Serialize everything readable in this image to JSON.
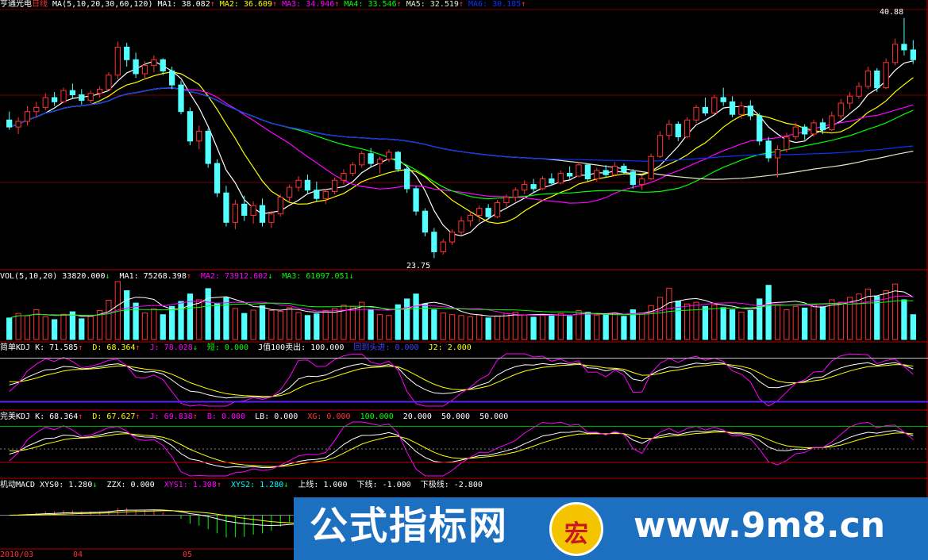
{
  "header": {
    "stock": "亨通光电",
    "period": "日线",
    "ma_params": "MA(5,10,20,30,60,120)",
    "ma1": "MA1: 38.082",
    "ma2": "MA2: 36.609",
    "ma3": "MA3: 34.946",
    "ma4": "MA4: 33.546",
    "ma5": "MA5: 32.519",
    "ma6": "MA6: 30.185",
    "high_label": "40.88",
    "low_label": "23.75"
  },
  "vol_header": {
    "params": "VOL(5,10,20)",
    "vol": "33820.000",
    "ma1": "MA1: 75268.398",
    "ma2": "MA2: 73912.602",
    "ma3": "MA3: 61097.051"
  },
  "kdj1_header": {
    "name": "简单KDJ",
    "k": "K: 71.585",
    "d": "D: 68.364",
    "j": "J: 78.028",
    "short": "短: 0.000",
    "jsell": "J值100卖出: 100.000",
    "bottom": "回到头进: 0.000",
    "j2": "J2: 2.000"
  },
  "kdj2_header": {
    "name": "完美KDJ",
    "k": "K: 68.364",
    "d": "D: 67.627",
    "j": "J: 69.838",
    "b": "B: 0.000",
    "lb": "LB: 0.000",
    "xg": "XG: 0.000",
    "v1": "100.000",
    "v2": "20.000",
    "v3": "50.000",
    "v4": "50.000"
  },
  "macd_header": {
    "name": "机动MACD",
    "xys0": "XYS0: 1.280",
    "zzx": "ZZX: 0.000",
    "xys1": "XYS1: 1.308",
    "xys2": "XYS2: 1.280",
    "upper": "上线: 1.000",
    "lower": "下线: -1.000",
    "floor": "下极线: -2.800"
  },
  "date_labels": [
    "2010/03",
    "04",
    "05"
  ],
  "watermark": {
    "text": "公式指标网",
    "url": "www.9m8.cn",
    "logo_char": "宏"
  },
  "colors": {
    "up": "#ff3232",
    "down": "#54ffff",
    "ma1": "#ffffff",
    "ma2": "#ffff00",
    "ma3": "#ff00ff",
    "ma4": "#00ff00",
    "ma5": "#e8e8c8",
    "ma6": "#0a32ff"
  },
  "chart_data": {
    "type": "candlestick",
    "price_range": [
      23.75,
      40.88
    ],
    "ohlc": [
      [
        33.6,
        34.2,
        32.9,
        33.1
      ],
      [
        33.1,
        33.8,
        32.6,
        33.5
      ],
      [
        33.5,
        34.6,
        33.2,
        34.2
      ],
      [
        34.2,
        34.9,
        33.8,
        34.5
      ],
      [
        34.5,
        35.5,
        34.3,
        35.2
      ],
      [
        35.2,
        35.6,
        34.6,
        34.9
      ],
      [
        34.9,
        35.9,
        34.8,
        35.7
      ],
      [
        35.7,
        36.2,
        35.1,
        35.4
      ],
      [
        35.4,
        35.8,
        34.7,
        35.0
      ],
      [
        35.0,
        35.7,
        34.8,
        35.5
      ],
      [
        35.5,
        36.0,
        35.2,
        35.8
      ],
      [
        35.8,
        37.0,
        35.7,
        36.8
      ],
      [
        36.8,
        39.2,
        36.5,
        38.8
      ],
      [
        38.8,
        39.1,
        37.4,
        37.9
      ],
      [
        37.9,
        38.4,
        36.6,
        36.9
      ],
      [
        36.9,
        37.8,
        36.5,
        37.5
      ],
      [
        37.5,
        38.2,
        37.0,
        37.9
      ],
      [
        37.9,
        38.0,
        36.8,
        37.1
      ],
      [
        37.1,
        37.4,
        35.8,
        36.1
      ],
      [
        36.1,
        36.4,
        34.0,
        34.2
      ],
      [
        34.2,
        34.5,
        31.8,
        32.1
      ],
      [
        32.1,
        33.2,
        31.5,
        32.8
      ],
      [
        32.8,
        33.0,
        30.2,
        30.5
      ],
      [
        30.5,
        30.8,
        28.1,
        28.4
      ],
      [
        28.4,
        28.9,
        26.0,
        26.3
      ],
      [
        26.3,
        27.9,
        25.8,
        27.6
      ],
      [
        27.6,
        28.2,
        26.4,
        26.8
      ],
      [
        26.8,
        27.8,
        26.2,
        27.5
      ],
      [
        27.5,
        28.0,
        26.0,
        26.3
      ],
      [
        26.3,
        27.1,
        25.9,
        26.9
      ],
      [
        26.9,
        28.3,
        26.7,
        28.1
      ],
      [
        28.1,
        29.0,
        27.8,
        28.8
      ],
      [
        28.8,
        29.6,
        28.5,
        29.3
      ],
      [
        29.3,
        29.7,
        28.3,
        28.6
      ],
      [
        28.6,
        29.2,
        27.8,
        28.0
      ],
      [
        28.0,
        28.7,
        27.6,
        28.5
      ],
      [
        28.5,
        29.5,
        28.3,
        29.3
      ],
      [
        29.3,
        30.1,
        29.0,
        29.8
      ],
      [
        29.8,
        30.6,
        29.6,
        30.4
      ],
      [
        30.4,
        31.4,
        30.2,
        31.2
      ],
      [
        31.2,
        31.6,
        30.2,
        30.5
      ],
      [
        30.5,
        31.0,
        29.8,
        30.8
      ],
      [
        30.8,
        31.5,
        30.6,
        31.3
      ],
      [
        31.3,
        31.4,
        29.9,
        30.1
      ],
      [
        30.1,
        30.3,
        28.4,
        28.7
      ],
      [
        28.7,
        28.9,
        26.8,
        27.1
      ],
      [
        27.1,
        27.3,
        25.3,
        25.6
      ],
      [
        25.6,
        25.9,
        23.75,
        24.2
      ],
      [
        24.2,
        25.1,
        24.0,
        24.9
      ],
      [
        24.9,
        25.8,
        24.7,
        25.6
      ],
      [
        25.6,
        26.7,
        25.4,
        26.4
      ],
      [
        26.4,
        27.1,
        26.0,
        26.8
      ],
      [
        26.8,
        27.5,
        26.3,
        27.3
      ],
      [
        27.3,
        27.6,
        26.5,
        26.7
      ],
      [
        26.7,
        27.9,
        26.6,
        27.7
      ],
      [
        27.7,
        28.3,
        27.4,
        28.1
      ],
      [
        28.1,
        28.8,
        27.8,
        28.6
      ],
      [
        28.6,
        29.3,
        28.3,
        29.0
      ],
      [
        29.0,
        29.4,
        28.4,
        28.7
      ],
      [
        28.7,
        29.6,
        28.6,
        29.4
      ],
      [
        29.4,
        29.8,
        28.9,
        29.1
      ],
      [
        29.1,
        30.0,
        29.0,
        29.8
      ],
      [
        29.8,
        30.3,
        29.4,
        29.6
      ],
      [
        29.6,
        30.6,
        29.5,
        30.4
      ],
      [
        30.4,
        30.5,
        29.2,
        29.4
      ],
      [
        29.4,
        30.2,
        29.2,
        30.0
      ],
      [
        30.0,
        30.4,
        29.5,
        29.7
      ],
      [
        29.7,
        30.6,
        29.6,
        30.3
      ],
      [
        30.3,
        30.5,
        29.7,
        29.9
      ],
      [
        29.9,
        30.1,
        28.7,
        29.0
      ],
      [
        29.0,
        29.6,
        28.6,
        29.4
      ],
      [
        29.4,
        31.2,
        29.3,
        31.0
      ],
      [
        31.0,
        32.8,
        30.9,
        32.5
      ],
      [
        32.5,
        33.6,
        32.2,
        33.3
      ],
      [
        33.3,
        33.5,
        32.1,
        32.4
      ],
      [
        32.4,
        33.8,
        32.3,
        33.6
      ],
      [
        33.6,
        34.7,
        33.4,
        34.5
      ],
      [
        34.5,
        35.2,
        33.9,
        34.1
      ],
      [
        34.1,
        35.4,
        34.0,
        35.2
      ],
      [
        35.2,
        35.9,
        34.6,
        34.9
      ],
      [
        34.9,
        35.3,
        33.8,
        34.0
      ],
      [
        34.0,
        34.9,
        33.7,
        34.6
      ],
      [
        34.6,
        35.0,
        33.6,
        33.9
      ],
      [
        33.9,
        34.1,
        31.8,
        32.1
      ],
      [
        32.1,
        32.4,
        30.6,
        30.9
      ],
      [
        30.9,
        31.8,
        29.5,
        31.5
      ],
      [
        31.5,
        32.7,
        31.3,
        32.4
      ],
      [
        32.4,
        33.4,
        32.2,
        33.1
      ],
      [
        33.1,
        33.3,
        32.2,
        32.6
      ],
      [
        32.6,
        33.6,
        32.4,
        33.4
      ],
      [
        33.4,
        33.7,
        32.6,
        32.9
      ],
      [
        32.9,
        34.2,
        32.8,
        33.9
      ],
      [
        33.9,
        35.1,
        33.7,
        34.8
      ],
      [
        34.8,
        35.6,
        34.4,
        35.3
      ],
      [
        35.3,
        36.3,
        35.1,
        36.0
      ],
      [
        36.0,
        37.4,
        35.8,
        37.1
      ],
      [
        37.1,
        37.3,
        35.6,
        35.9
      ],
      [
        35.9,
        38.0,
        35.8,
        37.7
      ],
      [
        37.7,
        39.4,
        37.5,
        39.0
      ],
      [
        39.0,
        40.88,
        38.2,
        38.6
      ],
      [
        38.6,
        39.3,
        37.6,
        37.9
      ]
    ],
    "volume": [
      52,
      63,
      58,
      72,
      55,
      48,
      61,
      67,
      50,
      56,
      70,
      95,
      140,
      118,
      88,
      64,
      74,
      60,
      80,
      92,
      110,
      96,
      123,
      88,
      101,
      75,
      63,
      71,
      82,
      70,
      68,
      77,
      65,
      58,
      62,
      70,
      75,
      83,
      79,
      90,
      72,
      60,
      58,
      84,
      98,
      110,
      86,
      72,
      64,
      60,
      58,
      55,
      60,
      52,
      57,
      63,
      66,
      59,
      54,
      61,
      58,
      63,
      56,
      70,
      66,
      59,
      61,
      64,
      56,
      72,
      64,
      82,
      102,
      124,
      93,
      86,
      90,
      80,
      84,
      77,
      72,
      66,
      70,
      98,
      131,
      83,
      72,
      80,
      76,
      85,
      79,
      96,
      90,
      102,
      110,
      122,
      104,
      118,
      134,
      96,
      60
    ],
    "ma_settings": [
      "MA(5,10,20,30,60,120)"
    ]
  }
}
